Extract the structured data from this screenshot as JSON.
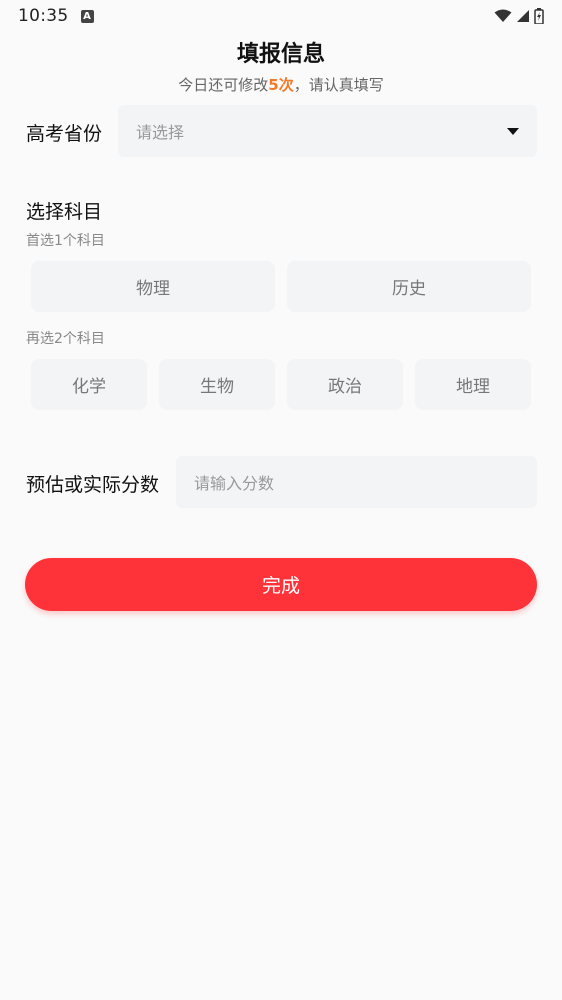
{
  "status_bar": {
    "time": "10:35",
    "notification_icon": "A"
  },
  "header": {
    "title": "填报信息",
    "subtitle_prefix": "今日还可修改",
    "subtitle_count": "5次",
    "subtitle_suffix": "，请认真填写"
  },
  "province": {
    "label": "高考省份",
    "placeholder": "请选择"
  },
  "subjects": {
    "title": "选择科目",
    "first_hint": "首选1个科目",
    "first_options": [
      "物理",
      "历史"
    ],
    "second_hint": "再选2个科目",
    "second_options": [
      "化学",
      "生物",
      "政治",
      "地理"
    ]
  },
  "score": {
    "label": "预估或实际分数",
    "placeholder": "请输入分数"
  },
  "submit": {
    "label": "完成"
  },
  "colors": {
    "accent": "#fe3339",
    "highlight": "#f07a2a",
    "field_bg": "#f2f4f6"
  }
}
